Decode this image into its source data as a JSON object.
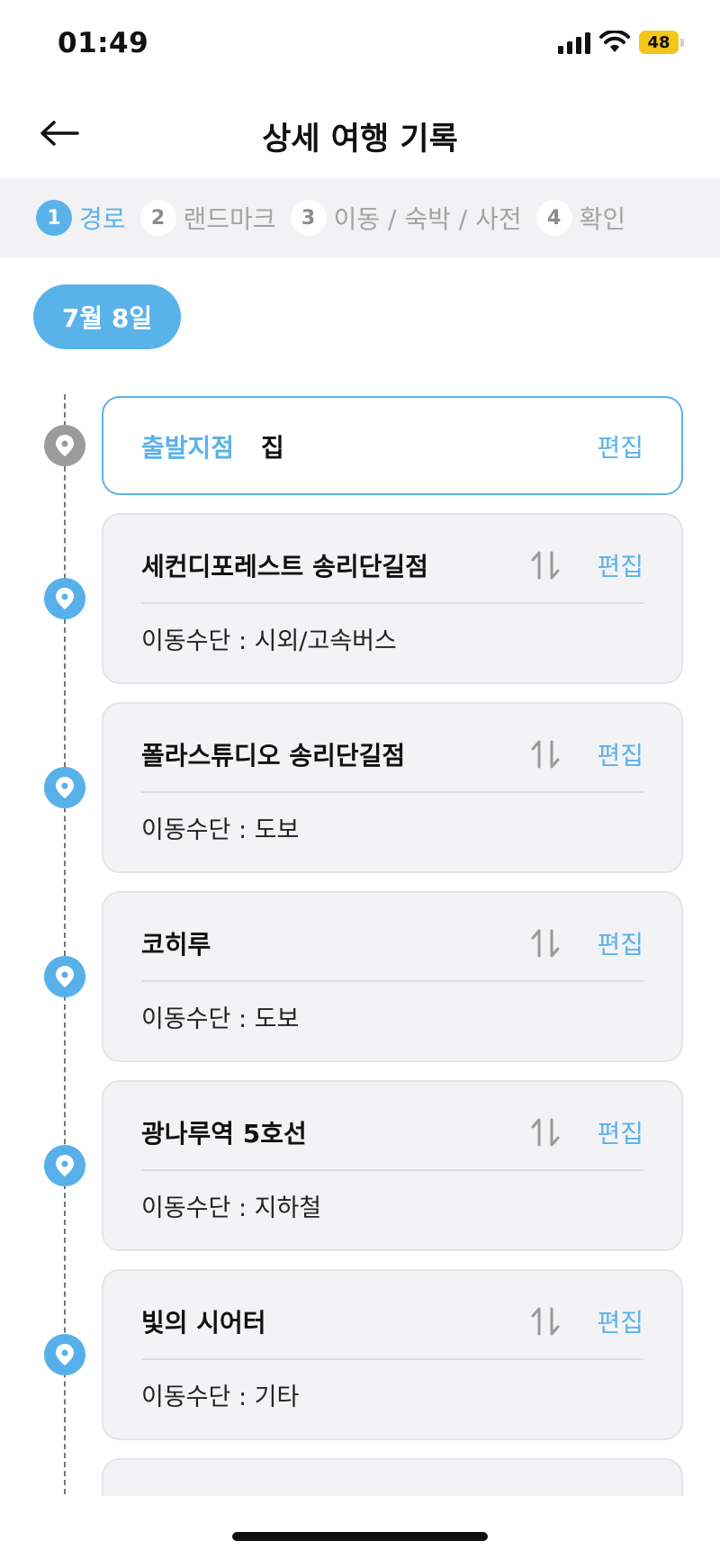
{
  "status_bar": {
    "time": "01:49",
    "battery": "48",
    "icons": [
      "signal-icon",
      "wifi-icon",
      "battery-icon"
    ],
    "battery_color": "#f5c518"
  },
  "header": {
    "title": "상세 여행 기록",
    "back_icon": "arrow-left-icon"
  },
  "stepper": {
    "steps": [
      {
        "num": "1",
        "label": "경로",
        "active": true
      },
      {
        "num": "2",
        "label": "랜드마크",
        "active": false
      },
      {
        "num": "3",
        "label": "이동 / 숙박 / 사전",
        "active": false
      },
      {
        "num": "4",
        "label": "확인",
        "active": false
      }
    ]
  },
  "date_chip": "7월 8일",
  "start": {
    "label": "출발지점",
    "value": "집",
    "edit": "편집"
  },
  "stops": [
    {
      "name": "세컨디포레스트 송리단길점",
      "transport": "이동수단 : 시외/고속버스",
      "edit": "편집"
    },
    {
      "name": "폴라스튜디오 송리단길점",
      "transport": "이동수단 : 도보",
      "edit": "편집"
    },
    {
      "name": "코히루",
      "transport": "이동수단 : 도보",
      "edit": "편집"
    },
    {
      "name": "광나루역 5호선",
      "transport": "이동수단 : 지하철",
      "edit": "편집"
    },
    {
      "name": "빛의 시어터",
      "transport": "이동수단 : 기타",
      "edit": "편집"
    }
  ],
  "colors": {
    "accent": "#5ab2ea",
    "pin_gray": "#9b9b9b",
    "card_bg": "#f3f3f5"
  }
}
